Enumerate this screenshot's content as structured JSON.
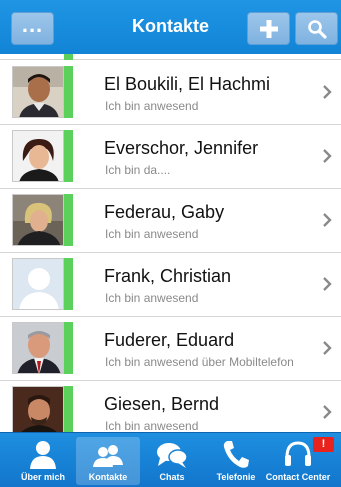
{
  "header": {
    "title": "Kontakte",
    "more_label": "...",
    "add_icon": "plus-icon",
    "search_icon": "search-icon",
    "color": "#1a8ddd"
  },
  "contacts": [
    {
      "name": "El Boukili, El Hachmi",
      "status": "Ich bin anwesend",
      "presence_color": "#5bd15b"
    },
    {
      "name": "Everschor, Jennifer",
      "status": "Ich bin da....",
      "presence_color": "#5bd15b"
    },
    {
      "name": "Federau, Gaby",
      "status": "Ich bin anwesend",
      "presence_color": "#5bd15b"
    },
    {
      "name": "Frank, Christian",
      "status": "Ich bin anwesend",
      "presence_color": "#5bd15b"
    },
    {
      "name": "Fuderer, Eduard",
      "status": "Ich bin anwesend über Mobiltelefon",
      "presence_color": "#5bd15b"
    },
    {
      "name": "Giesen, Bernd",
      "status": "Ich bin anwesend",
      "presence_color": "#5bd15b"
    }
  ],
  "tabs": [
    {
      "label": "Über mich",
      "icon": "person-icon",
      "active": false
    },
    {
      "label": "Kontakte",
      "icon": "contacts-icon",
      "active": true
    },
    {
      "label": "Chats",
      "icon": "chat-bubbles-icon",
      "active": false
    },
    {
      "label": "Telefonie",
      "icon": "phone-icon",
      "active": false
    },
    {
      "label": "Contact Center",
      "icon": "headset-icon",
      "active": false
    }
  ],
  "contact_center_badge": "!"
}
